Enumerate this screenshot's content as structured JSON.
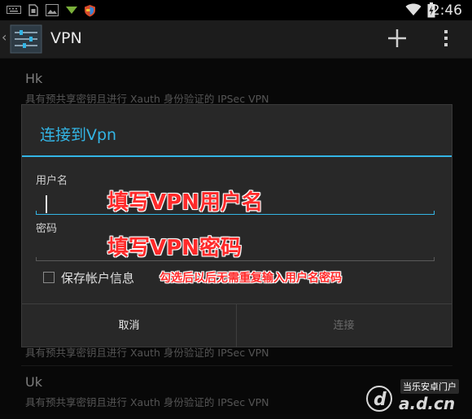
{
  "status_bar": {
    "time": "2:46",
    "icons": [
      "keyboard-icon",
      "sim-card-icon",
      "image-icon",
      "download-icon",
      "shield-app-icon",
      "wifi-icon",
      "battery-charging-icon"
    ]
  },
  "action_bar": {
    "title": "VPN",
    "icons": [
      "vpn-settings-icon",
      "add-icon",
      "overflow-menu-icon"
    ]
  },
  "vpn_list": [
    {
      "name": "Hk",
      "description": "具有预共享密钥且进行 Xauth 身份验证的 IPSec VPN"
    },
    {
      "name": "",
      "description": "具有预共享密钥且进行 Xauth 身份验证的 IPSec VPN"
    },
    {
      "name": "Uk",
      "description": "具有预共享密钥且进行 Xauth 身份验证的 IPSec VPN"
    }
  ],
  "dialog": {
    "title": "连接到Vpn",
    "username_label": "用户名",
    "username_value": "",
    "password_label": "密码",
    "password_value": "",
    "save_checkbox_label": "保存帐户信息",
    "save_checked": false,
    "cancel_label": "取消",
    "connect_label": "连接"
  },
  "annotations": {
    "username_hint": "填写VPN用户名",
    "password_hint": "填写VPN密码",
    "checkbox_hint": "勾选后以后无需重复输入用户名密码"
  },
  "watermark": {
    "brand_text": "当乐安卓门户",
    "domain_text": "a.d.cn"
  },
  "colors": {
    "accent": "#33b5e5",
    "annotation": "#ff2a2a",
    "background": "#101010"
  }
}
